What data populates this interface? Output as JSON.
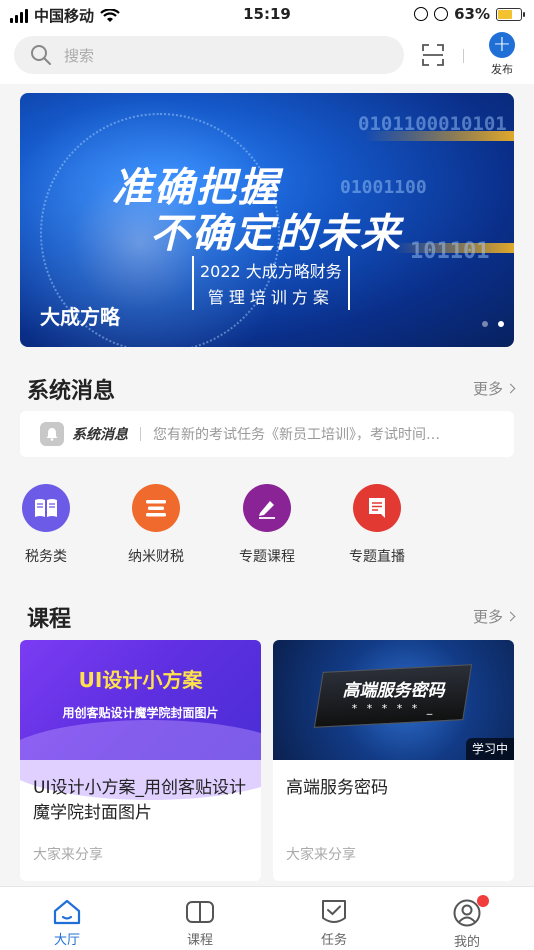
{
  "status_bar": {
    "carrier": "中国移动",
    "time": "15:19",
    "battery": "63%",
    "battery_level": 0.63
  },
  "header": {
    "search_placeholder": "搜索",
    "publish_label": "发布"
  },
  "banner": {
    "headline_line1": "准确把握",
    "headline_line2": "不确定的未来",
    "subtitle_line1": "2022 大成方略财务",
    "subtitle_line2": "管理培训方案",
    "caption": "大成方略",
    "binary_1": "0101100010101",
    "binary_2": "01001100",
    "binary_3": "101101",
    "slide_count": 2,
    "active_slide": 2
  },
  "messages": {
    "title": "系统消息",
    "more": "更多",
    "notice_label": "系统消息",
    "notice_text": "您有新的考试任务《新员工培训》，考试时间…"
  },
  "quick_menu": [
    {
      "label": "税务类",
      "color": "#6b5be6",
      "icon": "book-icon"
    },
    {
      "label": "纳米财税",
      "color": "#ef6a2c",
      "icon": "list-icon"
    },
    {
      "label": "专题课程",
      "color": "#8a2496",
      "icon": "pen-icon"
    },
    {
      "label": "专题直播",
      "color": "#e23a32",
      "icon": "document-icon"
    }
  ],
  "courses": {
    "title": "课程",
    "more": "更多",
    "items": [
      {
        "thumb_title": "UI设计小方案",
        "thumb_subtitle": "用创客贴设计魔学院封面图片",
        "title": "UI设计小方案_用创客贴设计魔学院封面图片",
        "author": "大家来分享"
      },
      {
        "thumb_title": "高端服务密码",
        "thumb_stars": "* * * * * _",
        "badge": "学习中",
        "title": "高端服务密码",
        "author": "大家来分享"
      }
    ]
  },
  "tabbar": {
    "items": [
      {
        "label": "大厅",
        "icon": "home-icon",
        "active": true
      },
      {
        "label": "课程",
        "icon": "book-open-icon",
        "active": false
      },
      {
        "label": "任务",
        "icon": "task-check-icon",
        "active": false
      },
      {
        "label": "我的",
        "icon": "user-icon",
        "active": false,
        "badge": true
      }
    ],
    "active_color": "#1f6fd6"
  }
}
